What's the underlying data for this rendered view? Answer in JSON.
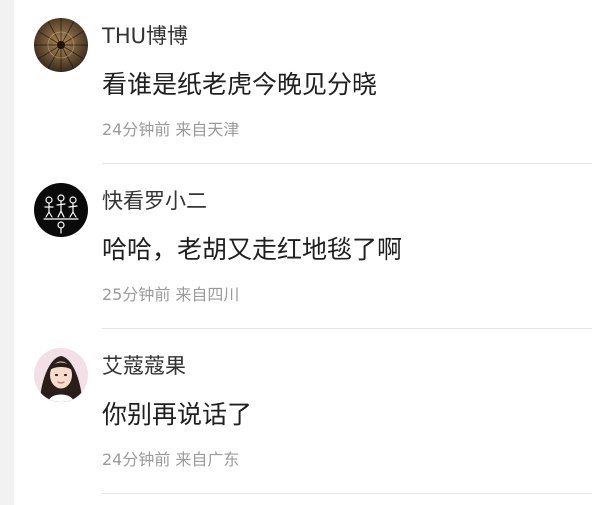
{
  "comments": [
    {
      "username": "THU博博",
      "text": "看谁是纸老虎今晚见分晓",
      "time": "24分钟前",
      "location": "来自天津",
      "avatar_icon": "umbrella-dome-avatar-icon"
    },
    {
      "username": "快看罗小二",
      "text": "哈哈，老胡又走红地毯了啊",
      "time": "25分钟前",
      "location": "来自四川",
      "avatar_icon": "figures-doodle-avatar-icon"
    },
    {
      "username": "艾蔻蔻果",
      "text": "你别再说话了",
      "time": "24分钟前",
      "location": "来自广东",
      "avatar_icon": "portrait-photo-avatar-icon"
    }
  ],
  "colors": {
    "username": "#333333",
    "text": "#1f1f1f",
    "meta": "#9b9b9b",
    "divider": "#e6e6e6",
    "rail": "#f2f2f2"
  }
}
